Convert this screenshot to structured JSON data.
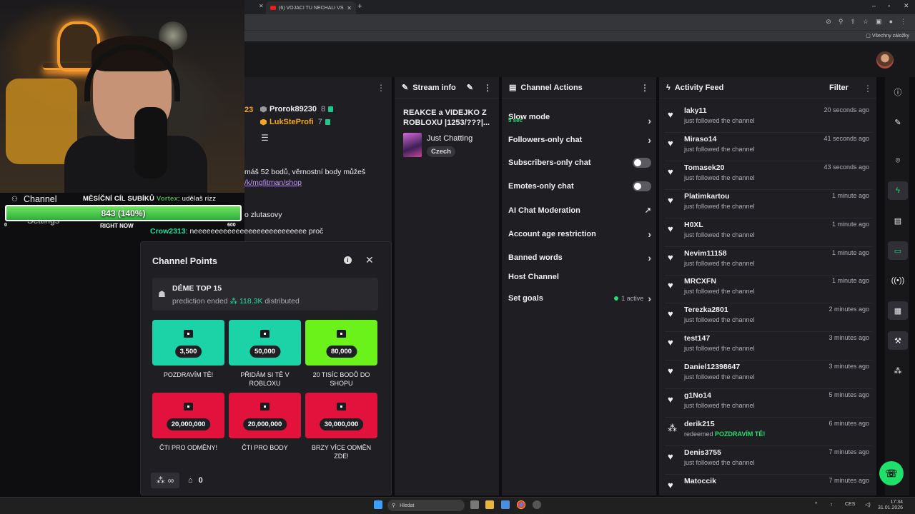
{
  "browser": {
    "tab_title": "(6) VOJÁCI TU NECHALI VŠECH...",
    "bookmarks_all": "Všechny záložky"
  },
  "overlay": {
    "channel_label": "Channel",
    "settings_label": "Settings",
    "goal_title": "MĚSÍČNÍ CÍL SUBÍKŮ",
    "goal_value": "843 (140%)",
    "goal_min": "0",
    "goal_max": "600",
    "goal_right": "RIGHT NOW",
    "goal_progress_percent": 140
  },
  "chat": {
    "badge_count": "23",
    "viewers": [
      {
        "name": "Prorok89230",
        "count": "8",
        "color": "#efeff1"
      },
      {
        "name": "LukSteProfi",
        "count": "7",
        "color": "#f5a623"
      }
    ],
    "messages": [
      {
        "text_pre": "máš 52 bodů, věrnostní body můžeš",
        "link": ""
      },
      {
        "text_pre": "",
        "link": "/k/mgfitman/shop"
      },
      {
        "user": "Vortex",
        "user_color": "#4caf50",
        "text": ": udělaš rizz"
      },
      {
        "text": "o zlutasovy"
      },
      {
        "user": "Crow2313",
        "user_color": "#1ee0a2",
        "text": ": neeeeeeeeeeeeeeeeeeeeeeeeeee proč"
      }
    ]
  },
  "channel_points": {
    "title": "Channel Points",
    "prediction": {
      "title": "DÉME TOP 15",
      "status": "prediction ended",
      "amount": "118.3K",
      "suffix": "distributed"
    },
    "rewards": [
      {
        "cost": "3,500",
        "label": "POZDRAVÍM TĚ!",
        "color": "#1bd3a7"
      },
      {
        "cost": "50,000",
        "label": "PŘIDÁM SI TĚ V ROBLOXU",
        "color": "#1bd3a7"
      },
      {
        "cost": "80,000",
        "label": "20 TISÍC BODŮ DO SHOPU",
        "color": "#6cf21b"
      },
      {
        "cost": "20,000,000",
        "label": "ČTI PRO ODMĚNY!",
        "color": "#e2123c"
      },
      {
        "cost": "20,000,000",
        "label": "ČTI PRO BODY",
        "color": "#e2123c"
      },
      {
        "cost": "30,000,000",
        "label": "BRZY VÍCE ODMĚN ZDE!",
        "color": "#e2123c"
      }
    ],
    "footer_infinity": "∞",
    "footer_store_count": "0"
  },
  "stream_info": {
    "header": "Stream info",
    "title": "REAKCE a VIDEJKO Z ROBLOXU |1253/???|...",
    "category": "Just Chatting",
    "tag": "Czech"
  },
  "channel_actions": {
    "header": "Channel Actions",
    "slow_mode": "Slow mode",
    "slow_mode_value": "5 sec",
    "followers_only": "Followers-only chat",
    "subscribers_only": "Subscribers-only chat",
    "emotes_only": "Emotes-only chat",
    "ai_moderation": "AI Chat Moderation",
    "age_restriction": "Account age restriction",
    "banned_words": "Banned words",
    "host_channel": "Host Channel",
    "set_goals": "Set goals",
    "goals_active": "1 active"
  },
  "activity_feed": {
    "header": "Activity Feed",
    "filter": "Filter",
    "items": [
      {
        "name": "laky11",
        "time": "20 seconds ago",
        "desc": "just followed the channel",
        "reward": ""
      },
      {
        "name": "Miraso14",
        "time": "41 seconds ago",
        "desc": "just followed the channel",
        "reward": ""
      },
      {
        "name": "Tomasek20",
        "time": "43 seconds ago",
        "desc": "just followed the channel",
        "reward": ""
      },
      {
        "name": "Platimkartou",
        "time": "1 minute ago",
        "desc": "just followed the channel",
        "reward": ""
      },
      {
        "name": "H0XL",
        "time": "1 minute ago",
        "desc": "just followed the channel",
        "reward": ""
      },
      {
        "name": "Nevim11158",
        "time": "1 minute ago",
        "desc": "just followed the channel",
        "reward": ""
      },
      {
        "name": "MRCXFN",
        "time": "1 minute ago",
        "desc": "just followed the channel",
        "reward": ""
      },
      {
        "name": "Terezka2801",
        "time": "2 minutes ago",
        "desc": "just followed the channel",
        "reward": ""
      },
      {
        "name": "test147",
        "time": "3 minutes ago",
        "desc": "just followed the channel",
        "reward": ""
      },
      {
        "name": "Daniel12398647",
        "time": "3 minutes ago",
        "desc": "just followed the channel",
        "reward": ""
      },
      {
        "name": "g1No14",
        "time": "5 minutes ago",
        "desc": "just followed the channel",
        "reward": ""
      },
      {
        "name": "derik215",
        "time": "6 minutes ago",
        "desc": "redeemed",
        "reward": "POZDRAVÍM TĚ!"
      },
      {
        "name": "Denis3755",
        "time": "7 minutes ago",
        "desc": "just followed the channel",
        "reward": ""
      },
      {
        "name": "Matoccik",
        "time": "7 minutes ago",
        "desc": "",
        "reward": ""
      }
    ]
  },
  "taskbar": {
    "search_placeholder": "Hledat",
    "lang": "CES",
    "time": "17:34",
    "date": "31.01.2026"
  }
}
